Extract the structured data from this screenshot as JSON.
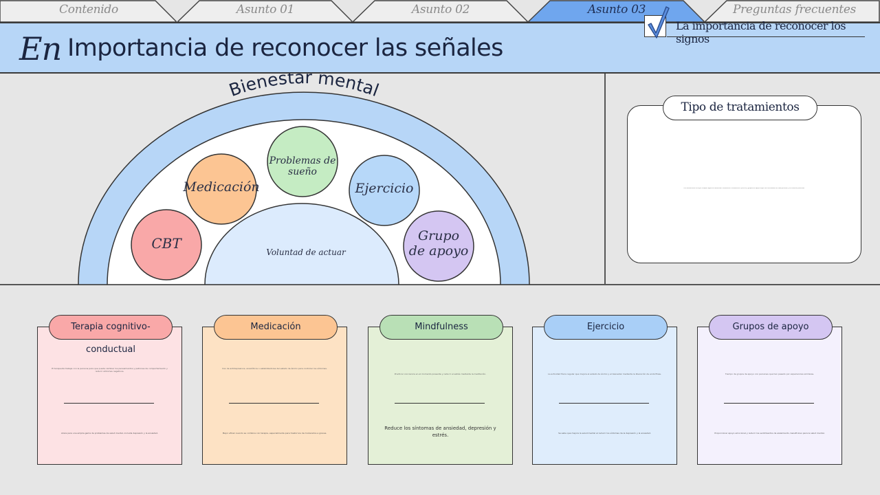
{
  "tabs": [
    {
      "label": "Contenido",
      "active": false
    },
    {
      "label": "Asunto 01",
      "active": false
    },
    {
      "label": "Asunto 02",
      "active": false
    },
    {
      "label": "Asunto 03",
      "active": true
    },
    {
      "label": "Preguntas frecuentes",
      "active": false
    }
  ],
  "header": {
    "prefix": "En",
    "title": "Importancia de reconocer las señales",
    "link": "La importancia de reconocer los signos"
  },
  "diagram": {
    "arc_label": "Bienestar mental",
    "center_label": "Voluntad de actuar",
    "bubbles": [
      {
        "label": "CBT",
        "color": "#f9a8a8"
      },
      {
        "label": "Medicación",
        "color": "#fcc593"
      },
      {
        "label": "Problemas de sueño",
        "color": "#c5ecc3"
      },
      {
        "label": "Ejercicio",
        "color": "#b7d8f9"
      },
      {
        "label": "Grupo de apoyo",
        "label_line1": "Grupo",
        "label_line2": "de apoyo",
        "color": "#d4c6f2"
      }
    ],
    "arc_color": "#b7d6f7",
    "center_color": "#dcebfd"
  },
  "treatments": {
    "title": "Tipo de tratamientos",
    "text": "Los tratamientos incluyen terapia cognitivo-conductual, medicación, mindfulness, ejercicio y grupos de apoyo según las necesidades de cada persona y su situación particular."
  },
  "cards": [
    {
      "title": "Terapia cognitivo-conductual",
      "description": "El terapeuta trabaja con la persona para que pueda cambiar los pensamientos y patrones de comportamiento y reducir síntomas negativos.",
      "benefit": "Alivia para una amplia gama de problemas de salud mental, incluida depresión y la ansiedad.",
      "bg": "#fde2e4",
      "title_bg": "#f9a8a8",
      "benefit_big": false
    },
    {
      "title": "Medicación",
      "description": "Uso de antidepresivos, ansiolíticos o estabilizadores del estado de ánimo para controlar los síntomas.",
      "benefit": "Mejor eficaz cuando se combina con terapia, especialmente para trastornos de moderados a graves.",
      "bg": "#fde2c4",
      "title_bg": "#fcc593",
      "benefit_big": false
    },
    {
      "title": "Mindfulness",
      "description": "Practicar conciencia en el momento presente y reducir el estrés mediante la meditación.",
      "benefit": "Reduce los síntomas de ansiedad, depresión y estrés.",
      "bg": "#e4f0d7",
      "title_bg": "#b9e0b6",
      "benefit_big": true
    },
    {
      "title": "Ejercicio",
      "description": "La actividad física regular que mejora el estado de ánimo y el bienestar mediante la liberación de endorfinas.",
      "benefit": "Se sabe que mejora la salud mental al reducir los síntomas de la depresión y la ansiedad.",
      "bg": "#dfedfc",
      "title_bg": "#a9cff7",
      "benefit_big": false
    },
    {
      "title": "Grupos de apoyo",
      "description": "Tiempo de grupos de apoyo con personas que han pasado por experiencias similares.",
      "benefit": "Proporcionar apoyo emocional y reducir los sentimientos de aislamiento, beneficioso para la salud mental.",
      "bg": "#f4f1fd",
      "title_bg": "#d4c6f2",
      "benefit_big": false
    }
  ]
}
